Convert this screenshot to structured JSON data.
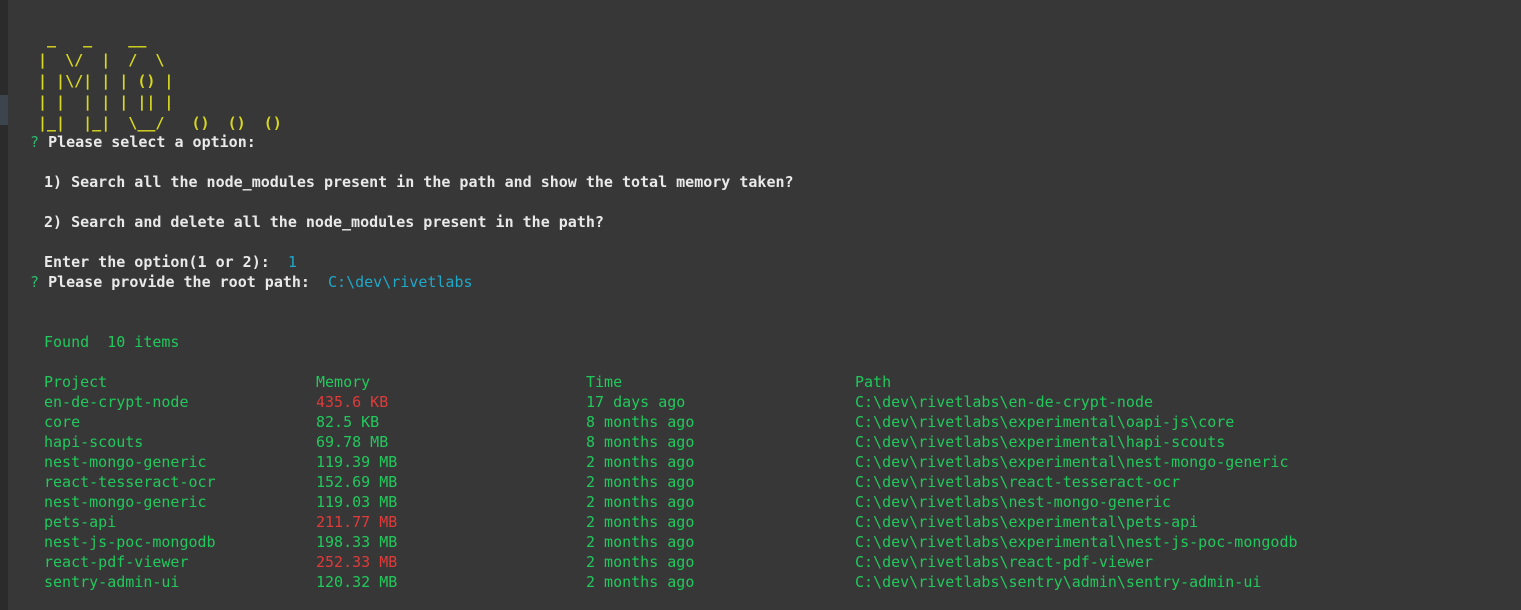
{
  "banner": {
    "name": "ascii-logo-mo",
    "art": " _   _    __\n|  \\/  |  /  \\\n| |\\/| | | () |\n| |  | | | || |\n|_|  |_|  \\__/   ()  ()  ()",
    "color": "#d8d81f"
  },
  "prompt": {
    "marker": "?",
    "select_label": "Please select a option:",
    "option_1": "1) Search all the node_modules present in the path and show the total memory taken?",
    "option_2": "2) Search and delete all the node_modules present in the path?",
    "enter_label": "Enter the option(1 or 2):",
    "enter_value": "1",
    "root_path_label": "Please provide the root path:",
    "root_path_value": "C:\\dev\\rivetlabs"
  },
  "results": {
    "found_label": "Found  10 items",
    "headers": {
      "project": "Project",
      "memory": "Memory",
      "time": "Time",
      "path": "Path"
    },
    "rows": [
      {
        "project": "en-de-crypt-node",
        "memory": "435.6 KB",
        "memory_color": "red",
        "time": "17 days ago",
        "path": "C:\\dev\\rivetlabs\\en-de-crypt-node"
      },
      {
        "project": "core",
        "memory": "82.5 KB",
        "memory_color": "green",
        "time": "8 months ago",
        "path": "C:\\dev\\rivetlabs\\experimental\\oapi-js\\core"
      },
      {
        "project": "hapi-scouts",
        "memory": "69.78 MB",
        "memory_color": "green",
        "time": "8 months ago",
        "path": "C:\\dev\\rivetlabs\\experimental\\hapi-scouts"
      },
      {
        "project": "nest-mongo-generic",
        "memory": "119.39 MB",
        "memory_color": "green",
        "time": "2 months ago",
        "path": "C:\\dev\\rivetlabs\\experimental\\nest-mongo-generic"
      },
      {
        "project": "react-tesseract-ocr",
        "memory": "152.69 MB",
        "memory_color": "green",
        "time": "2 months ago",
        "path": "C:\\dev\\rivetlabs\\react-tesseract-ocr"
      },
      {
        "project": "nest-mongo-generic",
        "memory": "119.03 MB",
        "memory_color": "green",
        "time": "2 months ago",
        "path": "C:\\dev\\rivetlabs\\nest-mongo-generic"
      },
      {
        "project": "pets-api",
        "memory": "211.77 MB",
        "memory_color": "red",
        "time": "2 months ago",
        "path": "C:\\dev\\rivetlabs\\experimental\\pets-api"
      },
      {
        "project": "nest-js-poc-mongodb",
        "memory": "198.33 MB",
        "memory_color": "green",
        "time": "2 months ago",
        "path": "C:\\dev\\rivetlabs\\experimental\\nest-js-poc-mongodb"
      },
      {
        "project": "react-pdf-viewer",
        "memory": "252.33 MB",
        "memory_color": "red",
        "time": "2 months ago",
        "path": "C:\\dev\\rivetlabs\\react-pdf-viewer"
      },
      {
        "project": "sentry-admin-ui",
        "memory": "120.32 MB",
        "memory_color": "green",
        "time": "2 months ago",
        "path": "C:\\dev\\rivetlabs\\sentry\\admin\\sentry-admin-ui"
      }
    ]
  },
  "colors": {
    "background": "#373737",
    "text": "#e9e9e9",
    "green": "#21c95c",
    "prompt_green": "#2cbb6e",
    "cyan": "#1fa8c8",
    "red": "#e03a3a",
    "yellow": "#d8d81f",
    "gutter": "#2b2b2b",
    "gutter_thumb": "#3c454e"
  }
}
